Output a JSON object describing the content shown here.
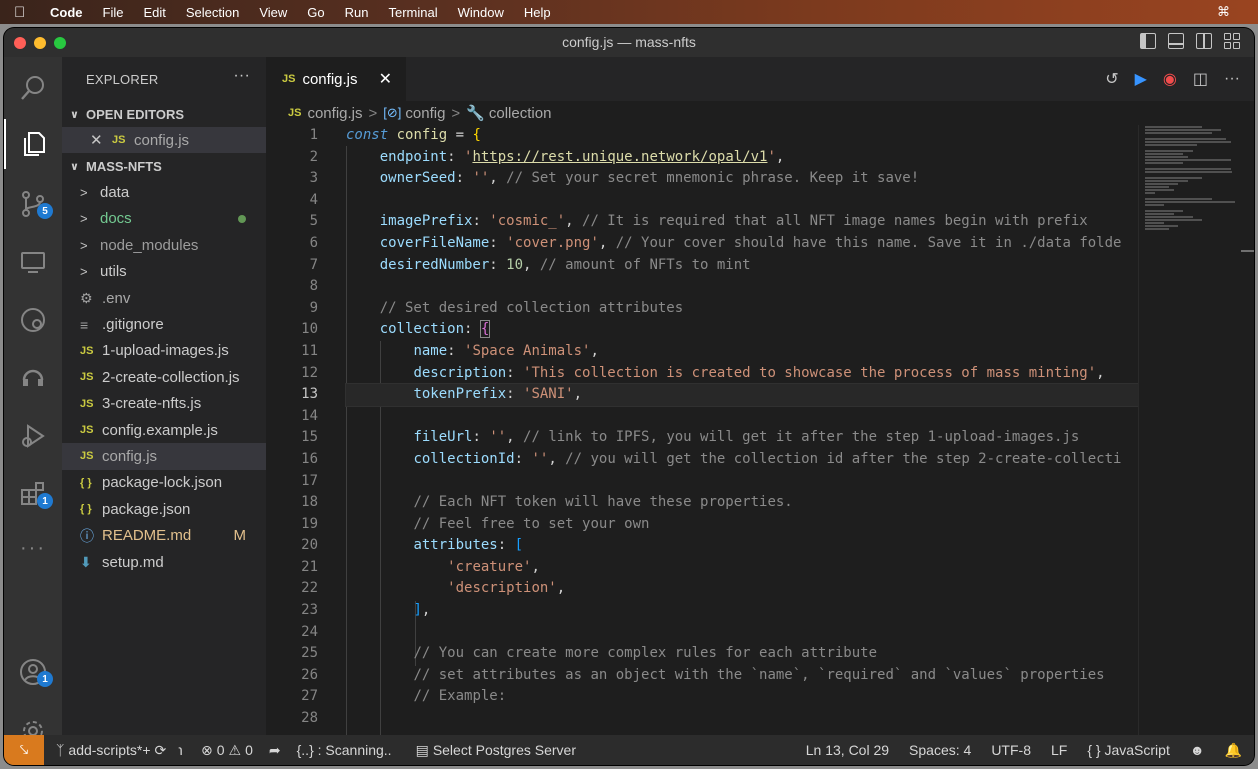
{
  "menubar": {
    "app": "Code",
    "items": [
      "File",
      "Edit",
      "Selection",
      "View",
      "Go",
      "Run",
      "Terminal",
      "Window",
      "Help"
    ]
  },
  "window": {
    "title": "config.js — mass-nfts"
  },
  "activity": {
    "scm_badge": "5",
    "extensions_badge": "1",
    "accounts_badge": "1"
  },
  "explorer": {
    "title": "EXPLORER",
    "open_editors_label": "OPEN EDITORS",
    "open_editor_file": "config.js",
    "project_label": "MASS-NFTS",
    "items": [
      {
        "name": "data",
        "type": "folder"
      },
      {
        "name": "docs",
        "type": "folder",
        "status": "dot"
      },
      {
        "name": "node_modules",
        "type": "folder"
      },
      {
        "name": "utils",
        "type": "folder"
      },
      {
        "name": ".env",
        "type": "env"
      },
      {
        "name": ".gitignore",
        "type": "gitignore"
      },
      {
        "name": "1-upload-images.js",
        "type": "js"
      },
      {
        "name": "2-create-collection.js",
        "type": "js"
      },
      {
        "name": "3-create-nfts.js",
        "type": "js"
      },
      {
        "name": "config.example.js",
        "type": "js"
      },
      {
        "name": "config.js",
        "type": "js",
        "selected": true
      },
      {
        "name": "package-lock.json",
        "type": "json"
      },
      {
        "name": "package.json",
        "type": "json"
      },
      {
        "name": "README.md",
        "type": "info",
        "status": "M"
      },
      {
        "name": "setup.md",
        "type": "md"
      }
    ]
  },
  "tab": {
    "label": "config.js",
    "icon": "JS"
  },
  "breadcrumb": {
    "file": "config.js",
    "symbol1": "config",
    "symbol2": "collection"
  },
  "editor": {
    "current_line": 13,
    "lines": [
      "1",
      "2",
      "3",
      "4",
      "5",
      "6",
      "7",
      "8",
      "9",
      "10",
      "11",
      "12",
      "13",
      "14",
      "15",
      "16",
      "17",
      "18",
      "19",
      "20",
      "21",
      "22",
      "23",
      "24",
      "25",
      "26",
      "27",
      "28"
    ],
    "code": {
      "l1_kw": "const",
      "l1_name": "config",
      "l2_key": "endpoint",
      "l2_url": "https://rest.unique.network/opal/v1",
      "l3_key": "ownerSeed",
      "l3_val": "''",
      "l3_comment": "// Set your secret mnemonic phrase. Keep it save!",
      "l5_key": "imagePrefix",
      "l5_val": "'cosmic_'",
      "l5_comment": "// It is required that all NFT image names begin with prefix",
      "l6_key": "coverFileName",
      "l6_val": "'cover.png'",
      "l6_comment": "// Your cover should have this name. Save it in ./data folde",
      "l7_key": "desiredNumber",
      "l7_val": "10",
      "l7_comment": "// amount of NFTs to mint",
      "l9_comment": "// Set desired collection attributes",
      "l10_key": "collection",
      "l11_key": "name",
      "l11_val": "'Space Animals'",
      "l12_key": "description",
      "l12_val": "'This collection is created to showcase the process of mass minting'",
      "l13_key": "tokenPrefix",
      "l13_val": "'SANI'",
      "l15_key": "fileUrl",
      "l15_val": "''",
      "l15_comment": "// link to IPFS, you will get it after the step 1-upload-images.js",
      "l16_key": "collectionId",
      "l16_val": "''",
      "l16_comment": "// you will get the collection id after the step 2-create-collecti",
      "l18_comment": "// Each NFT token will have these properties.",
      "l19_comment": "// Feel free to set your own",
      "l20_key": "attributes",
      "l21_val": "'creature'",
      "l22_val": "'description'",
      "l25_comment": "// You can create more complex rules for each attribute",
      "l26_comment": "// set attributes as an object with the `name`, `required` and `values` properties",
      "l27_comment": "// Example:"
    }
  },
  "statusbar": {
    "branch": "add-scripts*+",
    "errors": "0",
    "warnings": "0",
    "scanning": "{..} : Scanning..",
    "postgres": "Select Postgres Server",
    "position": "Ln 13, Col 29",
    "spaces": "Spaces: 4",
    "encoding": "UTF-8",
    "eol": "LF",
    "language_prefix": "{ }",
    "language": "JavaScript"
  },
  "colors": {
    "accent_remote": "#d97a1e",
    "badge": "#1f7ad1"
  }
}
